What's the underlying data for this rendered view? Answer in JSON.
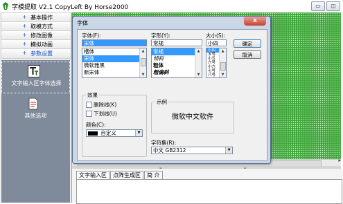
{
  "window": {
    "title": "字模提取 V2.1  CopyLeft By Horse2000",
    "buttons": {
      "minimize": "▭",
      "maximize": "◫"
    }
  },
  "nav": {
    "items": [
      {
        "plus": "+",
        "label": "基本操作"
      },
      {
        "plus": "+",
        "label": "取模方式"
      },
      {
        "plus": "+",
        "label": "修改图像"
      },
      {
        "plus": "+",
        "label": "模拟动画"
      },
      {
        "plus": "+",
        "label": "参数设置"
      }
    ],
    "tools": [
      {
        "label": "文字输入区字体选择"
      },
      {
        "label": "其他选项"
      }
    ]
  },
  "bottom_tabs": [
    "文字输入区",
    "点阵生成区",
    "简 介"
  ],
  "dialog": {
    "title": "字体",
    "close": "x",
    "font_label": "字体(F):",
    "font_value": "宋体",
    "font_list": [
      "楷体",
      "宋体",
      "微软雅黑",
      "新宋体"
    ],
    "font_selected_index": 1,
    "style_label": "字形(Y):",
    "style_value": "常规",
    "style_list": [
      "常规",
      "倾斜",
      "粗体",
      "粗偏斜"
    ],
    "style_selected_index": 0,
    "size_label": "大小(S):",
    "size_value": "小四",
    "size_list": [
      "小四",
      "五号",
      "小五",
      "六号",
      "小六",
      "七号",
      "八号"
    ],
    "size_selected_index": 0,
    "ok": "确定",
    "cancel": "取消",
    "effects_title": "效果",
    "strikeout": "删除线(K)",
    "underline": "下划线(U)",
    "color_label": "颜色(C):",
    "color_value": "自定义",
    "sample_title": "示例",
    "sample_text": "微软中文软件",
    "charset_label": "字符集(R):",
    "charset_value": "中文 GB2312"
  },
  "colors": {
    "canvas": "#3ea53a",
    "nav_panel": "#7f8a9a",
    "selection": "#3399ff"
  }
}
